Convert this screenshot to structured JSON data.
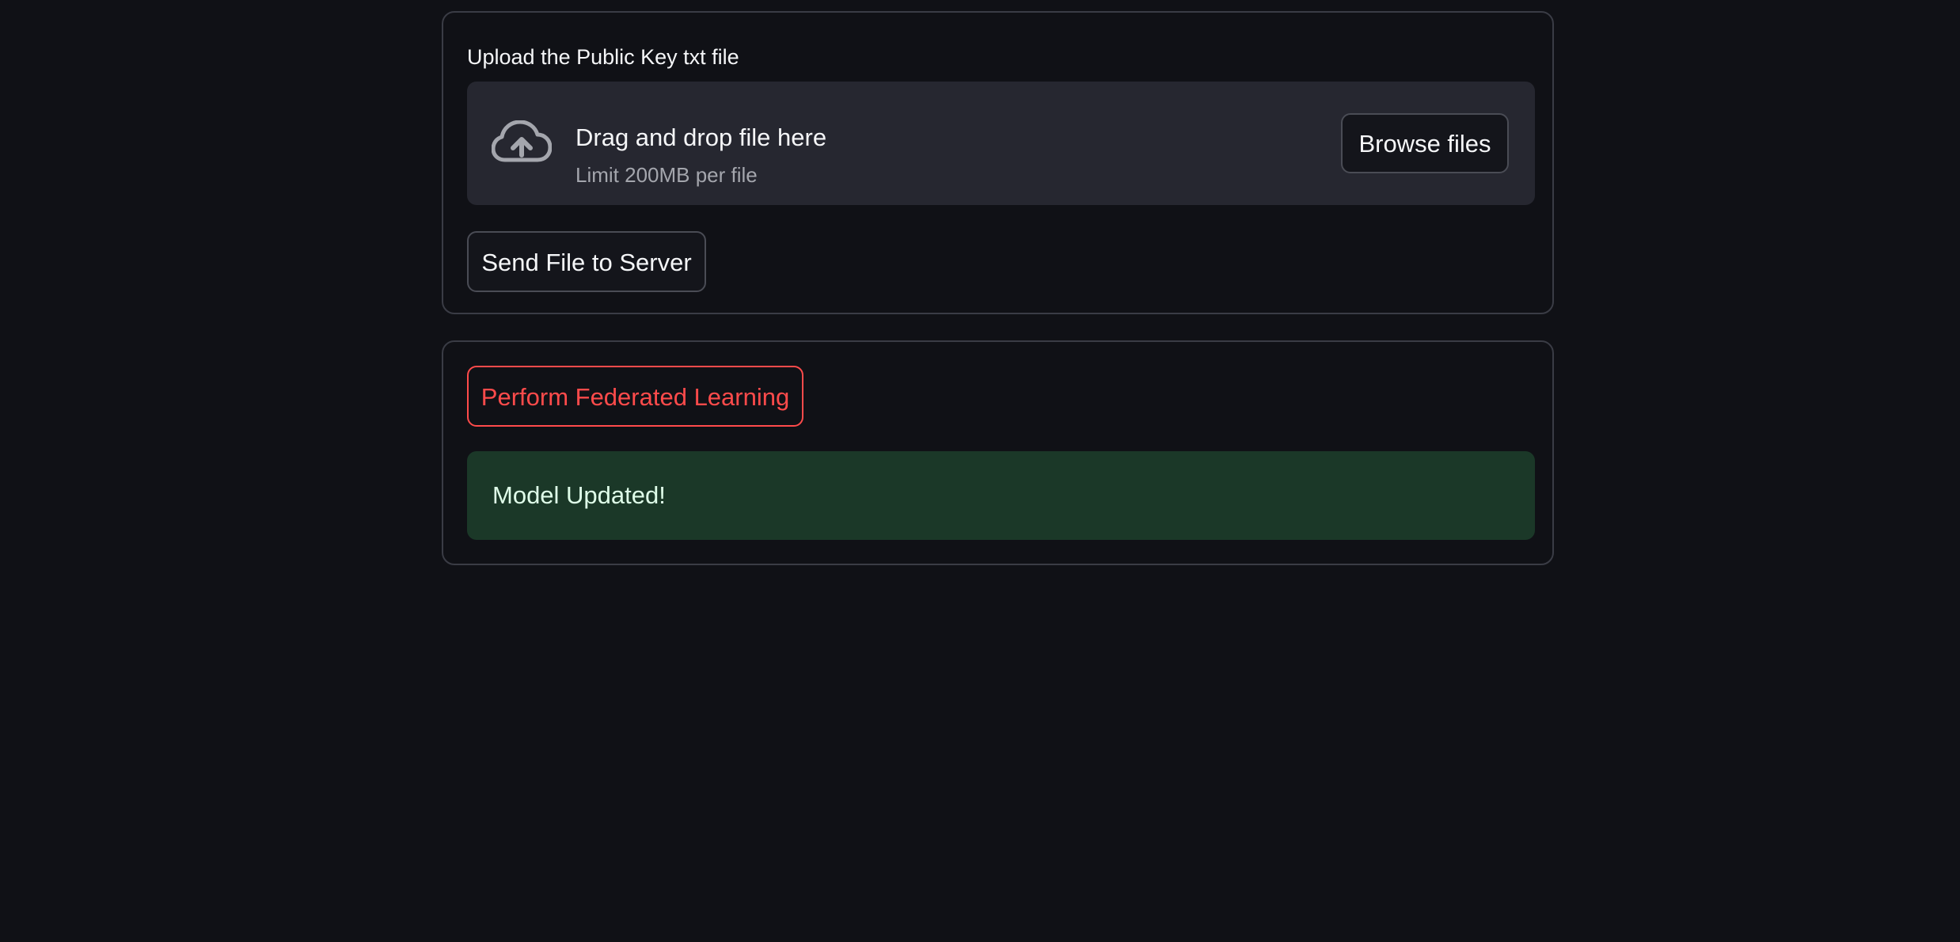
{
  "upload": {
    "label": "Upload the Public Key txt file",
    "dropzone": {
      "icon": "cloud-upload-icon",
      "title": "Drag and drop file here",
      "subtitle": "Limit 200MB per file"
    },
    "browse_label": "Browse files",
    "send_label": "Send File to Server"
  },
  "federated": {
    "button_label": "Perform Federated Learning",
    "status": {
      "message": "Model Updated!",
      "type": "success"
    }
  },
  "colors": {
    "background": "#101116",
    "dropzone": "#262730",
    "accent": "#ff4b4b",
    "success_bg": "#1b3828",
    "success_text": "#dffde9"
  }
}
